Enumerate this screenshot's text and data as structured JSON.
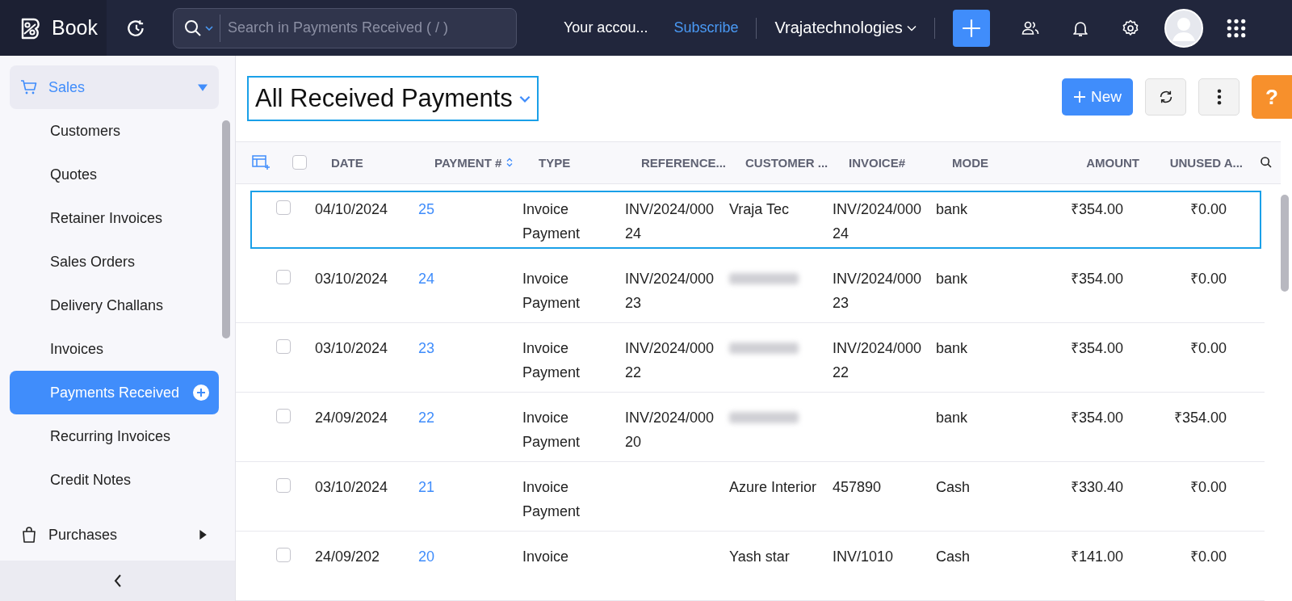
{
  "topbar": {
    "app_name": "Book",
    "search": {
      "placeholder": "Search in Payments Received ( / )"
    },
    "account_text": "Your accou...",
    "subscribe_link": "Subscribe",
    "organization": "Vrajatechnologies"
  },
  "sidebar": {
    "sections": [
      {
        "label": "Sales",
        "expanded": true,
        "items": [
          {
            "label": "Customers",
            "selected": false
          },
          {
            "label": "Quotes",
            "selected": false
          },
          {
            "label": "Retainer Invoices",
            "selected": false
          },
          {
            "label": "Sales Orders",
            "selected": false
          },
          {
            "label": "Delivery Challans",
            "selected": false
          },
          {
            "label": "Invoices",
            "selected": false
          },
          {
            "label": "Payments Received",
            "selected": true
          },
          {
            "label": "Recurring Invoices",
            "selected": false
          },
          {
            "label": "Credit Notes",
            "selected": false
          }
        ]
      },
      {
        "label": "Purchases",
        "expanded": false
      }
    ]
  },
  "toolbar": {
    "view_title": "All Received Payments",
    "new_button": "New",
    "help_button": "?"
  },
  "table": {
    "all_checked": false,
    "columns": [
      "DATE",
      "PAYMENT #",
      "TYPE",
      "REFERENCE...",
      "CUSTOMER ...",
      "INVOICE#",
      "MODE",
      "AMOUNT",
      "UNUSED A..."
    ],
    "rows": [
      {
        "focused": true,
        "checked": false,
        "date": "04/10/2024",
        "payment": "25",
        "type": "Invoice Payment",
        "reference": "INV/2024/00024",
        "customer": "Vraja Tec",
        "customer_blurred": false,
        "invoice": "INV/2024/00024",
        "mode": "bank",
        "amount": "₹354.00",
        "unused": "₹0.00"
      },
      {
        "focused": false,
        "checked": false,
        "date": "03/10/2024",
        "payment": "24",
        "type": "Invoice Payment",
        "reference": "INV/2024/00023",
        "customer": "",
        "customer_blurred": true,
        "invoice": "INV/2024/00023",
        "mode": "bank",
        "amount": "₹354.00",
        "unused": "₹0.00"
      },
      {
        "focused": false,
        "checked": false,
        "date": "03/10/2024",
        "payment": "23",
        "type": "Invoice Payment",
        "reference": "INV/2024/00022",
        "customer": "",
        "customer_blurred": true,
        "invoice": "INV/2024/00022",
        "mode": "bank",
        "amount": "₹354.00",
        "unused": "₹0.00"
      },
      {
        "focused": false,
        "checked": false,
        "date": "24/09/2024",
        "payment": "22",
        "type": "Invoice Payment",
        "reference": "INV/2024/00020",
        "customer": "",
        "customer_blurred": true,
        "invoice": "",
        "mode": "bank",
        "amount": "₹354.00",
        "unused": "₹354.00"
      },
      {
        "focused": false,
        "checked": false,
        "date": "03/10/2024",
        "payment": "21",
        "type": "Invoice Payment",
        "reference": "",
        "customer": "Azure Interior",
        "customer_blurred": false,
        "invoice": "457890",
        "mode": "Cash",
        "amount": "₹330.40",
        "unused": "₹0.00"
      },
      {
        "focused": false,
        "checked": false,
        "date": "24/09/202",
        "payment": "20",
        "type": "Invoice",
        "reference": "",
        "customer": "Yash star",
        "customer_blurred": false,
        "invoice": "INV/1010",
        "mode": "Cash",
        "amount": "₹141.00",
        "unused": "₹0.00"
      }
    ]
  }
}
